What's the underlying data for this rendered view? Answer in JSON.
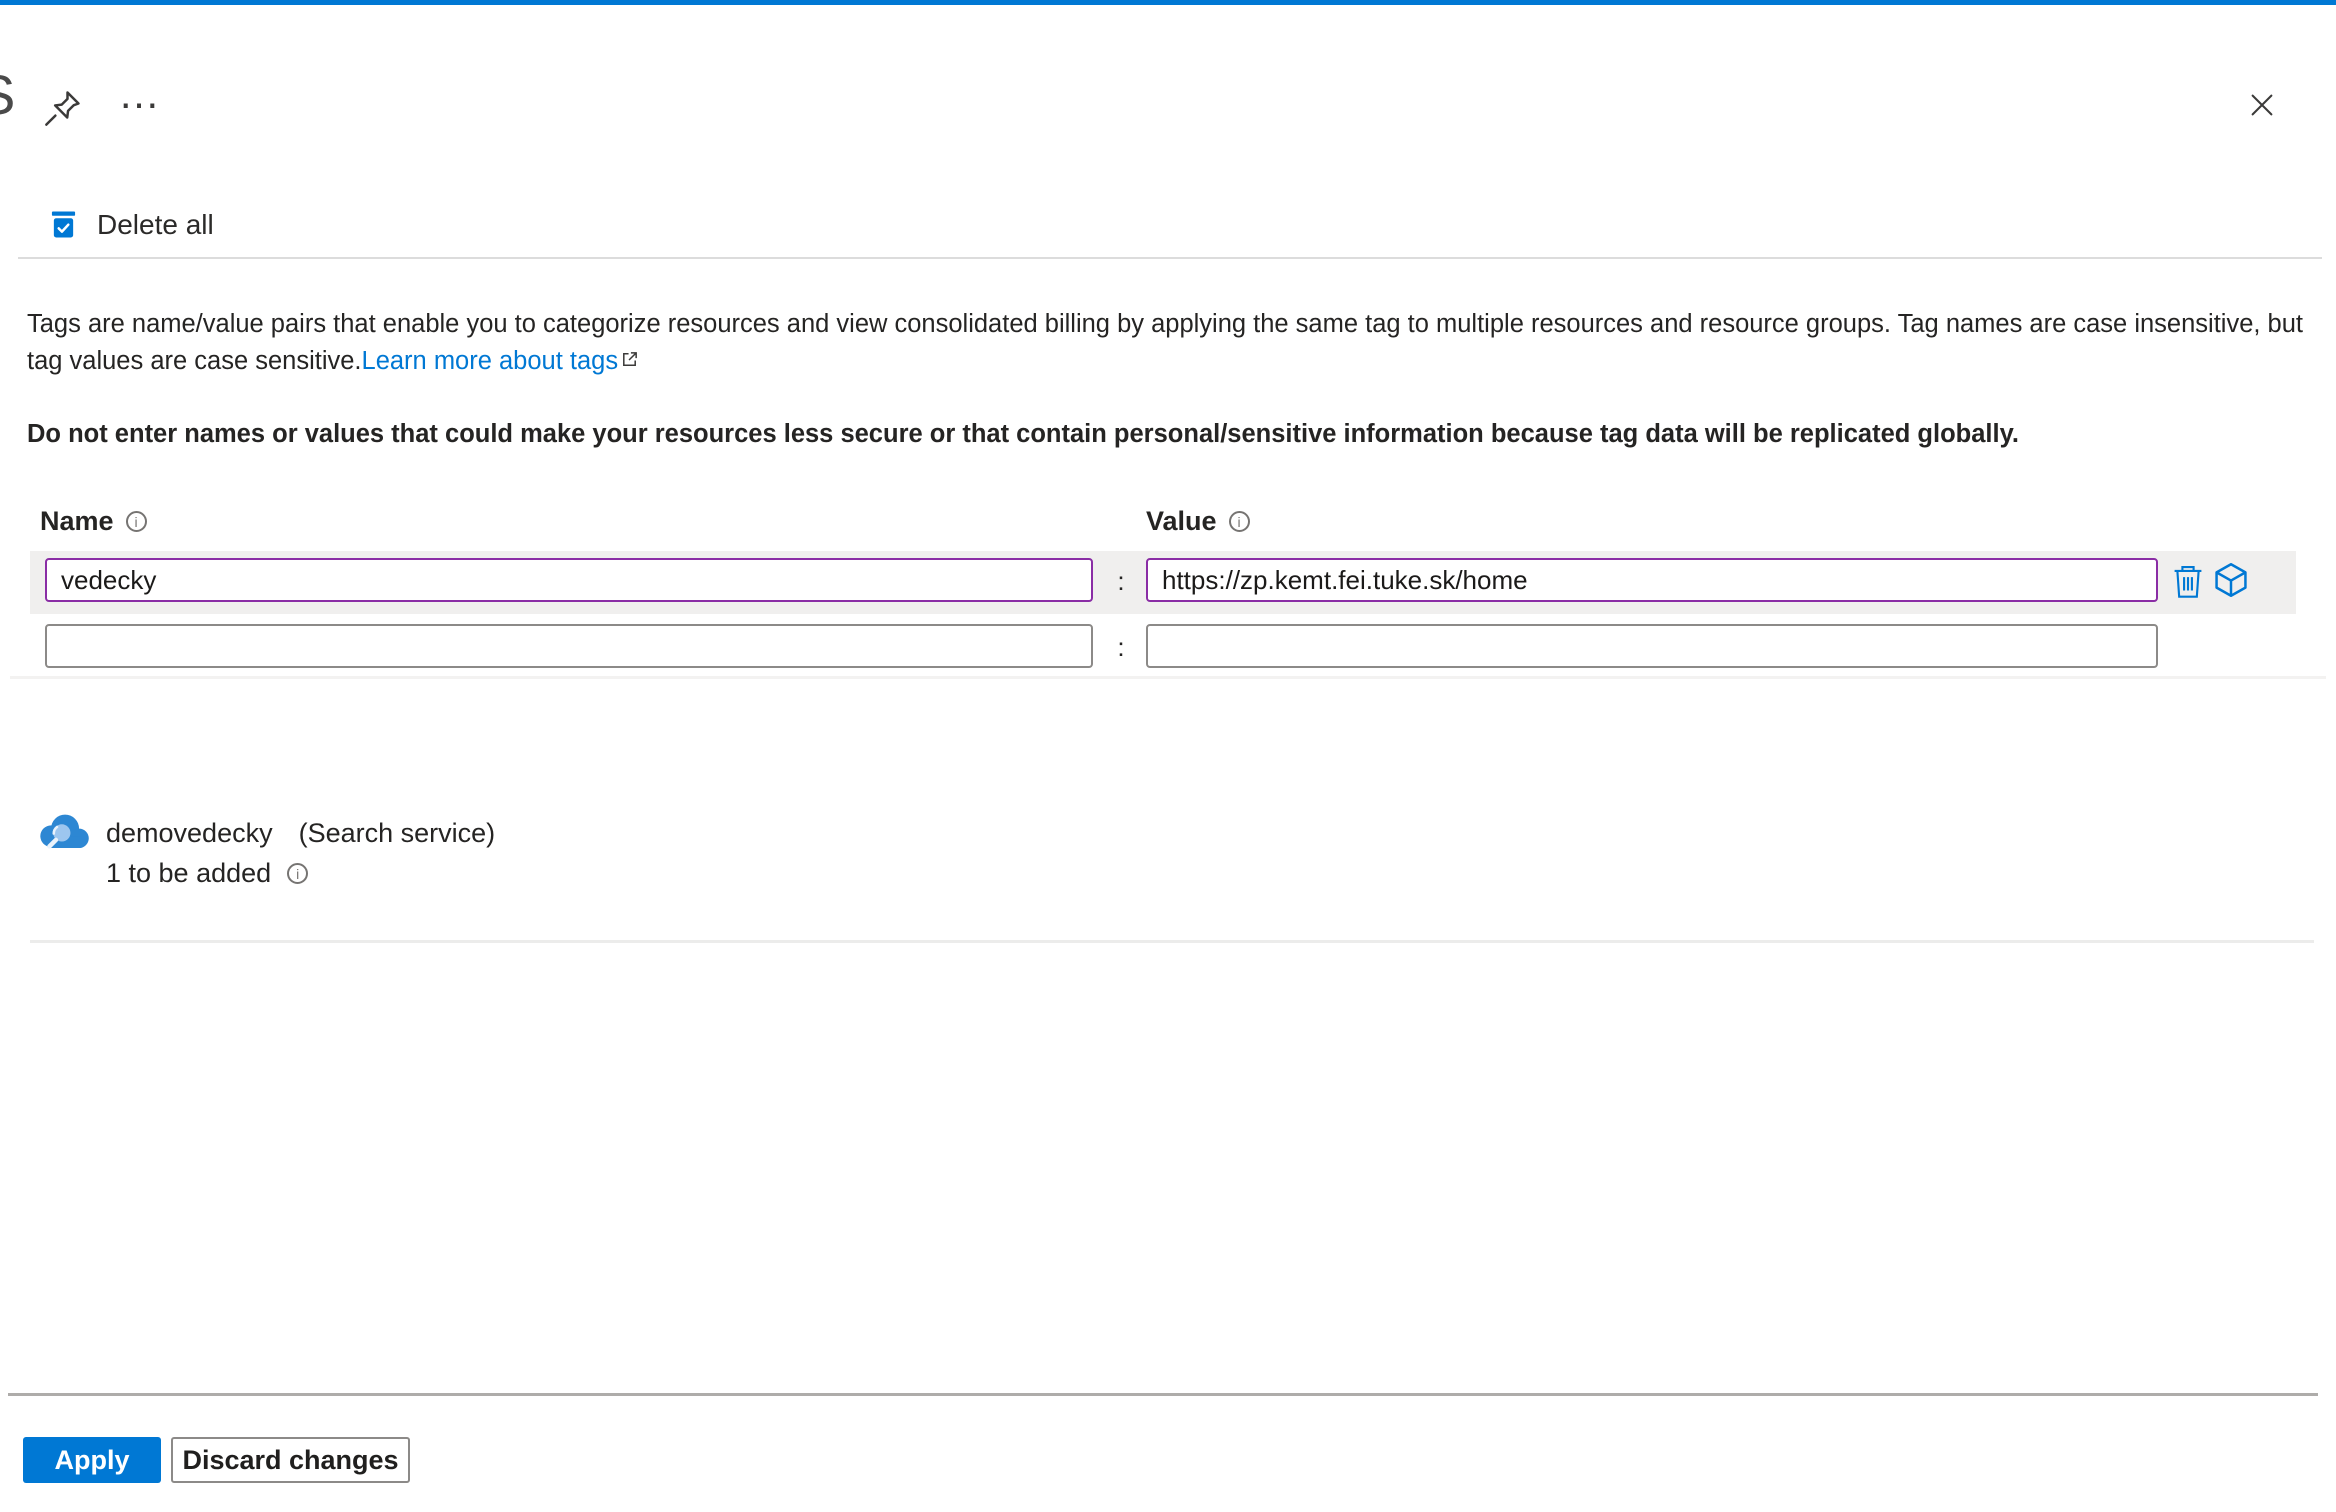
{
  "colors": {
    "accent": "#0078d4",
    "link": "#0078d4",
    "modified_field_border": "#8a2da5",
    "action_icon": "#0078d4",
    "row_highlight": "#f0efee"
  },
  "header": {
    "partial_title": "S",
    "more_glyph": "…"
  },
  "command_bar": {
    "delete_all": "Delete all"
  },
  "description": {
    "text": "Tags are name/value pairs that enable you to categorize resources and view consolidated billing by applying the same tag to multiple resources and resource groups. Tag names are case insensitive, but tag values are case sensitive.",
    "link": "Learn more about tags"
  },
  "warning": "Do not enter names or values that could make your resources less secure or that contain personal/sensitive information because tag data will be replicated globally.",
  "tags_table": {
    "name_header": "Name",
    "value_header": "Value",
    "separator": ":",
    "info_glyph": "i",
    "rows": [
      {
        "name": "vedecky",
        "value": "https://zp.kemt.fei.tuke.sk/home"
      },
      {
        "name": "",
        "value": ""
      }
    ]
  },
  "resource": {
    "name": "demovedecky",
    "type": "(Search service)",
    "pending": "1 to be added"
  },
  "footer": {
    "apply": "Apply",
    "discard": "Discard changes"
  },
  "icons": {
    "pin": "pushpin",
    "more": "ellipsis",
    "close": "x",
    "delete_all": "trash-with-check",
    "external_link": "arrow-out-of-box",
    "info": "i-in-circle",
    "delete_tag": "trash-outline",
    "assign_tag": "cube-outline",
    "resource": "search-service-cloud"
  }
}
